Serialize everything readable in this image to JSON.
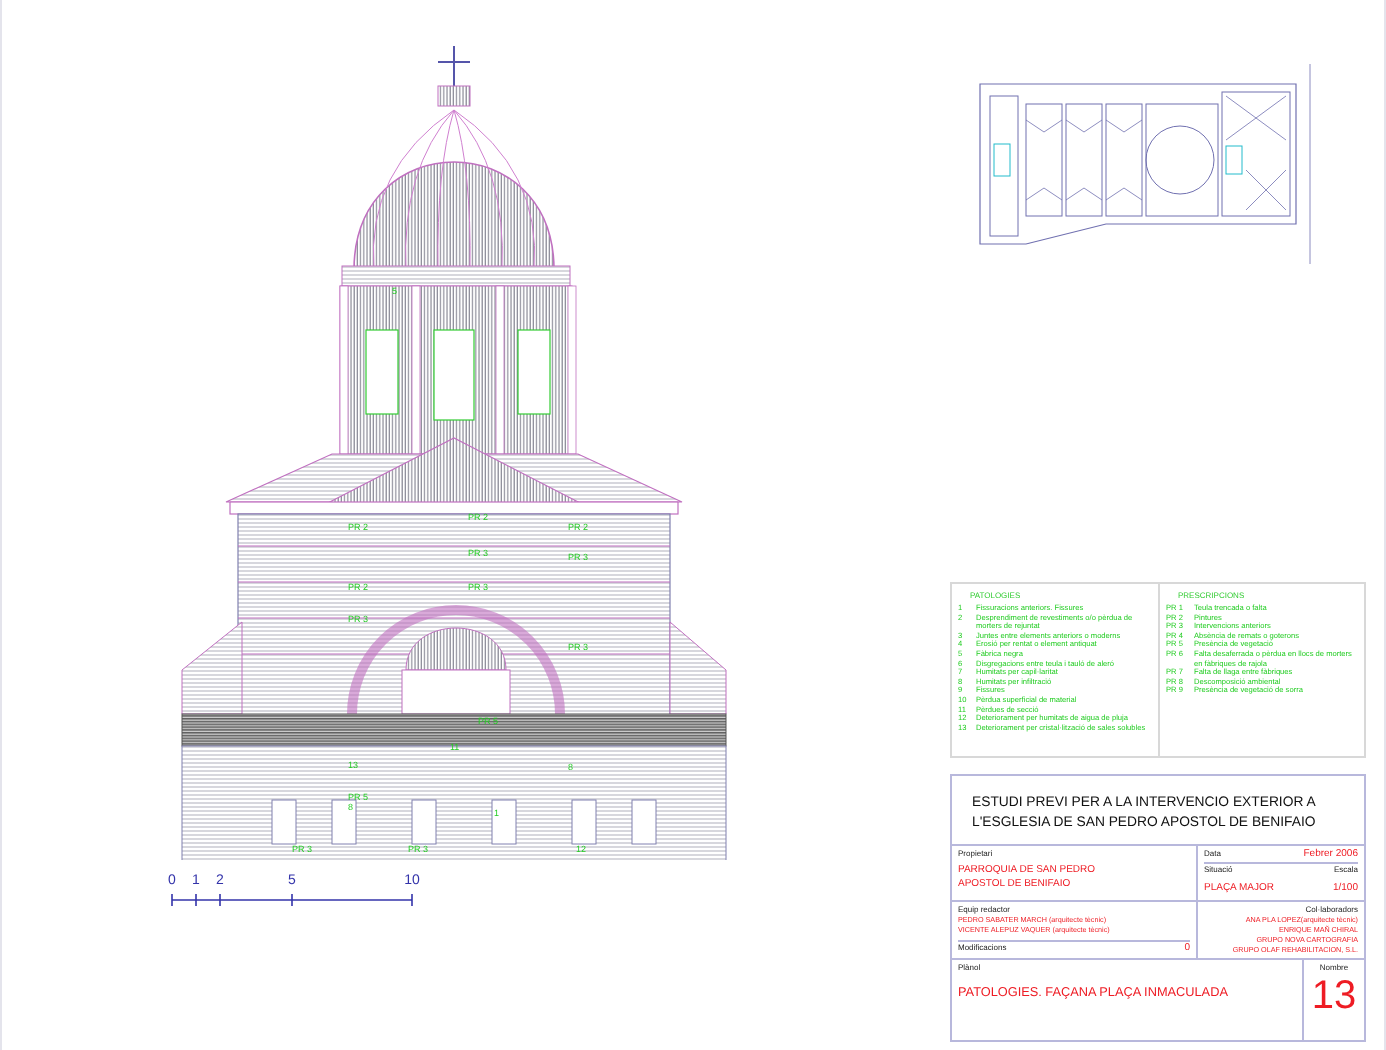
{
  "elevation": {
    "tags": [
      {
        "label": "5"
      },
      {
        "label": "PR 2"
      },
      {
        "label": "PR 2"
      },
      {
        "label": "PR 2"
      },
      {
        "label": "PR 2"
      },
      {
        "label": "PR 3"
      },
      {
        "label": "PR 3"
      },
      {
        "label": "PR 3"
      },
      {
        "label": "PR 3"
      },
      {
        "label": "PR 3"
      },
      {
        "label": "PR 5"
      },
      {
        "label": "PR 5"
      },
      {
        "label": "8"
      },
      {
        "label": "8"
      },
      {
        "label": "12"
      },
      {
        "label": "13"
      },
      {
        "label": "1"
      },
      {
        "label": "11"
      },
      {
        "label": "PR 3"
      },
      {
        "label": "PR 3"
      }
    ]
  },
  "scale_bar": {
    "ticks": [
      "0",
      "1",
      "2",
      "5",
      "10"
    ]
  },
  "legend": {
    "columns": [
      {
        "heading": "PATOLOGIES",
        "items": [
          {
            "code": "1",
            "text": "Fissuracions anteriors. Fissures"
          },
          {
            "code": "2",
            "text": "Desprendiment de revestiments o/o pèrdua de morters de rejuntat"
          },
          {
            "code": "3",
            "text": "Juntes entre elements anteriors o moderns"
          },
          {
            "code": "4",
            "text": "Erosió per rentat o element antiquat"
          },
          {
            "code": "5",
            "text": "Fàbrica negra"
          },
          {
            "code": "6",
            "text": "Disgregacions entre teula i tauló de aleró"
          },
          {
            "code": "7",
            "text": "Humitats per capil·laritat"
          },
          {
            "code": "8",
            "text": "Humitats per infiltració"
          },
          {
            "code": "9",
            "text": "Fissures"
          },
          {
            "code": "10",
            "text": "Pèrdua superficial de material"
          },
          {
            "code": "11",
            "text": "Pèrdues de secció"
          },
          {
            "code": "12",
            "text": "Deteriorament per humitats de aigua de pluja"
          },
          {
            "code": "13",
            "text": "Deteriorament per cristal·lització de sales solubles"
          }
        ]
      },
      {
        "heading": "PRESCRIPCIONS",
        "items": [
          {
            "code": "PR 1",
            "text": "Teula trencada o falta"
          },
          {
            "code": "PR 2",
            "text": "Pintures"
          },
          {
            "code": "PR 3",
            "text": "Intervencions anteriors"
          },
          {
            "code": "PR 4",
            "text": "Absència de remats o goterons"
          },
          {
            "code": "PR 5",
            "text": "Presència de vegetació"
          },
          {
            "code": "PR 6",
            "text": "Falta desaferrada o pèrdua en llocs de morters en fàbriques de rajola"
          },
          {
            "code": "PR 7",
            "text": "Falta de llaga entre fàbriques"
          },
          {
            "code": "PR 8",
            "text": "Descomposició ambiental"
          },
          {
            "code": "PR 9",
            "text": "Presència de vegetació de sorra"
          }
        ]
      }
    ]
  },
  "title_block": {
    "title": "ESTUDI PREVI PER A LA INTERVENCIO EXTERIOR A L'ESGLESIA DE SAN PEDRO APOSTOL DE BENIFAIO",
    "owner_label": "Propietari",
    "owner": "PARROQUIA DE SAN PEDRO APOSTOL DE BENIFAIO",
    "date_label": "Data",
    "date": "Febrer 2006",
    "location_label": "Situació",
    "location": "PLAÇA MAJOR",
    "scale_label": "Escala",
    "scale": "1/100",
    "team_label": "Equip redactor",
    "team": [
      "PEDRO SABATER MARCH (arquitecte tècnic)",
      "VICENTE ALEPUZ VAQUER (arquitecte tècnic)"
    ],
    "collaborators_label": "Col·laboradors",
    "collaborators": [
      "ANA PLA LOPEZ(arquitecte tècnic)",
      "ENRIQUE MAÑ CHIRAL",
      "GRUPO NOVA CARTOGRAFIA",
      "GRUPO OLAF REHABILITACION, S.L."
    ],
    "modifications_label": "Modificacions",
    "modifications": "0",
    "plan_label": "Plànol",
    "plan": "PATOLOGIES. FAÇANA PLAÇA INMACULADA",
    "number_label": "Nombre",
    "number": "13"
  }
}
